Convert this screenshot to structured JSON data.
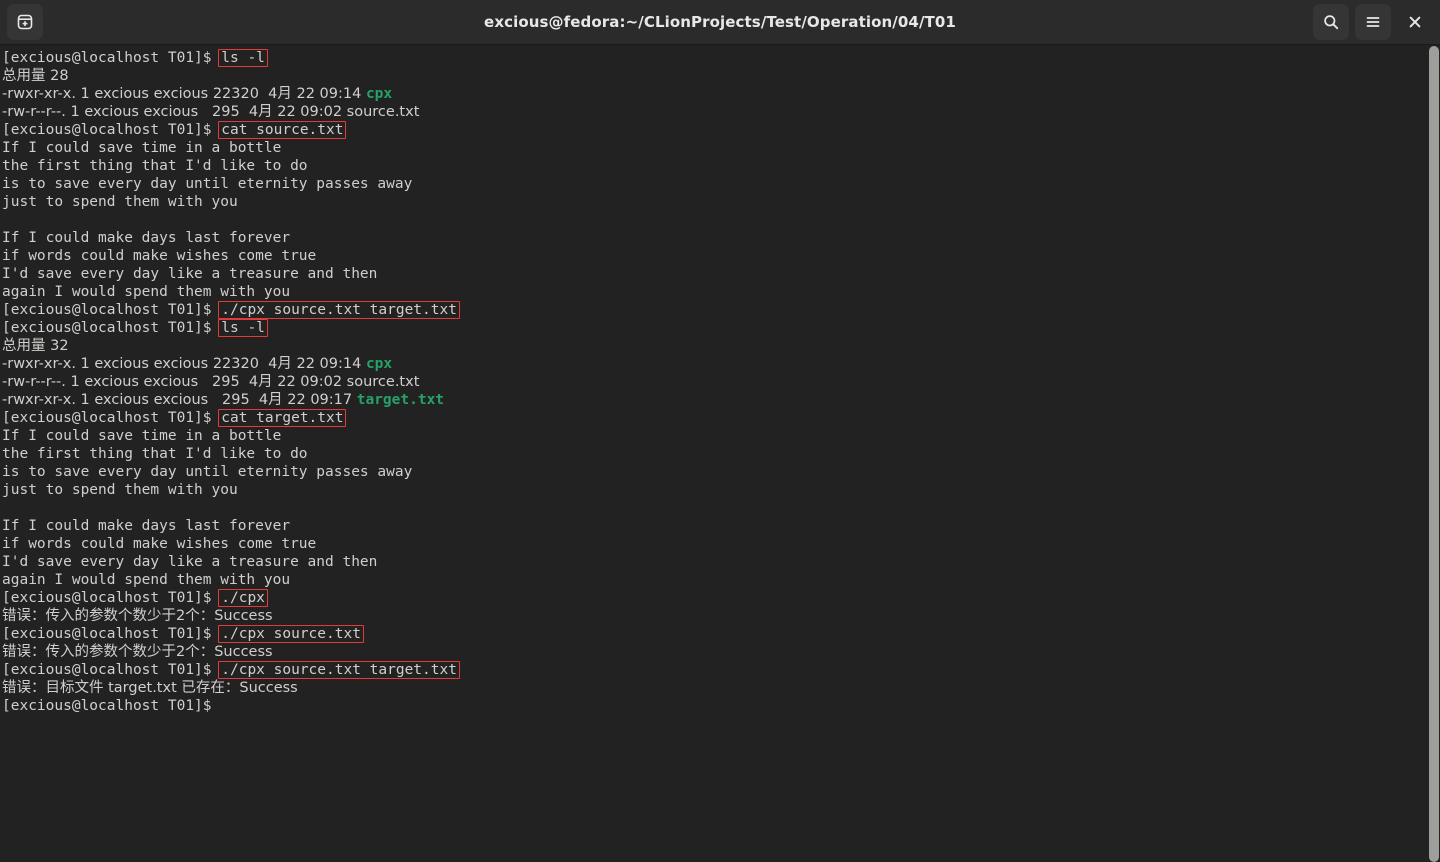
{
  "window": {
    "title": "excious@fedora:~/CLionProjects/Test/Operation/04/T01"
  },
  "titlebar": {
    "new_tab_label": "new-terminal",
    "search_label": "Search",
    "menu_label": "Main Menu",
    "close_label": "Close"
  },
  "colors": {
    "titlebar_bg": "#2b2b2b",
    "terminal_bg": "#222222",
    "text": "#d0cfcc",
    "green": "#26a269",
    "highlight_border": "#e23b3b",
    "scrollbar": "#9e9e9b"
  },
  "terminal": {
    "prompt": "[excious@localhost T01]$ ",
    "lines": [
      {
        "type": "prompt",
        "prompt": "[excious@localhost T01]$ ",
        "command": "ls -l"
      },
      {
        "type": "text",
        "text": "总用量 28",
        "cjk": true
      },
      {
        "type": "text",
        "text": "-rwxr-xr-x. 1 excious excious 22320  4月 22 09:14 ",
        "green": "cpx",
        "cjk": true
      },
      {
        "type": "text",
        "text": "-rw-r--r--. 1 excious excious   295  4月 22 09:02 source.txt",
        "cjk": true
      },
      {
        "type": "prompt",
        "prompt": "[excious@localhost T01]$ ",
        "command": "cat source.txt"
      },
      {
        "type": "text",
        "text": "If I could save time in a bottle"
      },
      {
        "type": "text",
        "text": "the first thing that I'd like to do"
      },
      {
        "type": "text",
        "text": "is to save every day until eternity passes away"
      },
      {
        "type": "text",
        "text": "just to spend them with you"
      },
      {
        "type": "blank",
        "text": ""
      },
      {
        "type": "text",
        "text": "If I could make days last forever"
      },
      {
        "type": "text",
        "text": "if words could make wishes come true"
      },
      {
        "type": "text",
        "text": "I'd save every day like a treasure and then"
      },
      {
        "type": "text",
        "text": "again I would spend them with you"
      },
      {
        "type": "prompt",
        "prompt": "[excious@localhost T01]$ ",
        "command": "./cpx source.txt target.txt"
      },
      {
        "type": "prompt",
        "prompt": "[excious@localhost T01]$ ",
        "command": "ls -l"
      },
      {
        "type": "text",
        "text": "总用量 32",
        "cjk": true
      },
      {
        "type": "text",
        "text": "-rwxr-xr-x. 1 excious excious 22320  4月 22 09:14 ",
        "green": "cpx",
        "cjk": true
      },
      {
        "type": "text",
        "text": "-rw-r--r--. 1 excious excious   295  4月 22 09:02 source.txt",
        "cjk": true
      },
      {
        "type": "text",
        "text": "-rwxr-xr-x. 1 excious excious   295  4月 22 09:17 ",
        "green": "target.txt",
        "cjk": true
      },
      {
        "type": "prompt",
        "prompt": "[excious@localhost T01]$ ",
        "command": "cat target.txt"
      },
      {
        "type": "text",
        "text": "If I could save time in a bottle"
      },
      {
        "type": "text",
        "text": "the first thing that I'd like to do"
      },
      {
        "type": "text",
        "text": "is to save every day until eternity passes away"
      },
      {
        "type": "text",
        "text": "just to spend them with you"
      },
      {
        "type": "blank",
        "text": ""
      },
      {
        "type": "text",
        "text": "If I could make days last forever"
      },
      {
        "type": "text",
        "text": "if words could make wishes come true"
      },
      {
        "type": "text",
        "text": "I'd save every day like a treasure and then"
      },
      {
        "type": "text",
        "text": "again I would spend them with you"
      },
      {
        "type": "prompt",
        "prompt": "[excious@localhost T01]$ ",
        "command": "./cpx"
      },
      {
        "type": "text",
        "text": "错误：传入的参数个数少于2个：Success",
        "cjk": true
      },
      {
        "type": "prompt",
        "prompt": "[excious@localhost T01]$ ",
        "command": "./cpx source.txt"
      },
      {
        "type": "text",
        "text": "错误：传入的参数个数少于2个：Success",
        "cjk": true
      },
      {
        "type": "prompt",
        "prompt": "[excious@localhost T01]$ ",
        "command": "./cpx source.txt target.txt"
      },
      {
        "type": "text",
        "text": "错误：目标文件 target.txt 已存在：Success",
        "cjk": true
      },
      {
        "type": "prompt",
        "prompt": "[excious@localhost T01]$ ",
        "command": ""
      }
    ]
  }
}
